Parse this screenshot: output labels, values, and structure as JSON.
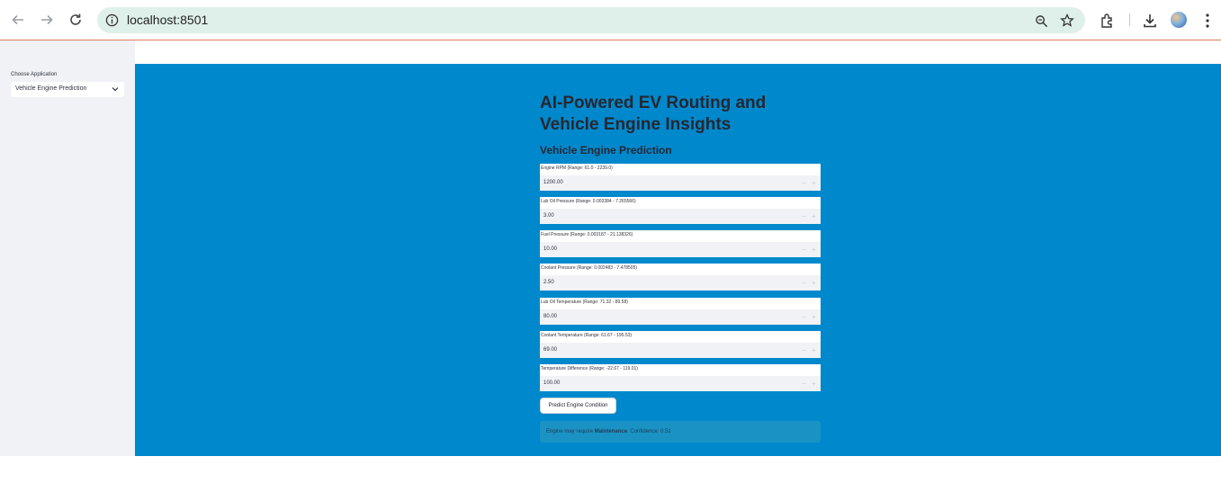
{
  "browser": {
    "url": "localhost:8501"
  },
  "sidebar": {
    "label": "Choose Application",
    "selected": "Vehicle Engine Prediction"
  },
  "main": {
    "title": "AI-Powered EV Routing and Vehicle Engine Insights",
    "subtitle": "Vehicle Engine Prediction",
    "fields": [
      {
        "label": "Engine RPM (Range: 61.0 - 2239.0)",
        "value": "1200.00"
      },
      {
        "label": "Lub Oil Pressure (Range: 0.003384 - 7.265566)",
        "value": "3.00"
      },
      {
        "label": "Fuel Pressure (Range: 0.003187 - 21.138326)",
        "value": "10.00"
      },
      {
        "label": "Coolant Pressure (Range: 0.002483 - 7.478505)",
        "value": "2.50"
      },
      {
        "label": "Lub Oil Temperature (Range: 71.32 - 89.58)",
        "value": "80.00"
      },
      {
        "label": "Coolant Temperature (Range: 61.67 - 195.53)",
        "value": "69.00"
      },
      {
        "label": "Temperature Difference (Range: -22.67 - 119.01)",
        "value": "100.00"
      }
    ],
    "predict_button": "Predict Engine Condition",
    "result": {
      "prefix": "Engine may require ",
      "status": "Maintenance",
      "suffix": ". Confidence: 0.51"
    }
  },
  "colors": {
    "main_bg": "#0088cc",
    "sidebar_bg": "#f0f2f6",
    "result_bg": "#1a93c4",
    "omnibox_bg": "#dff0ea"
  }
}
